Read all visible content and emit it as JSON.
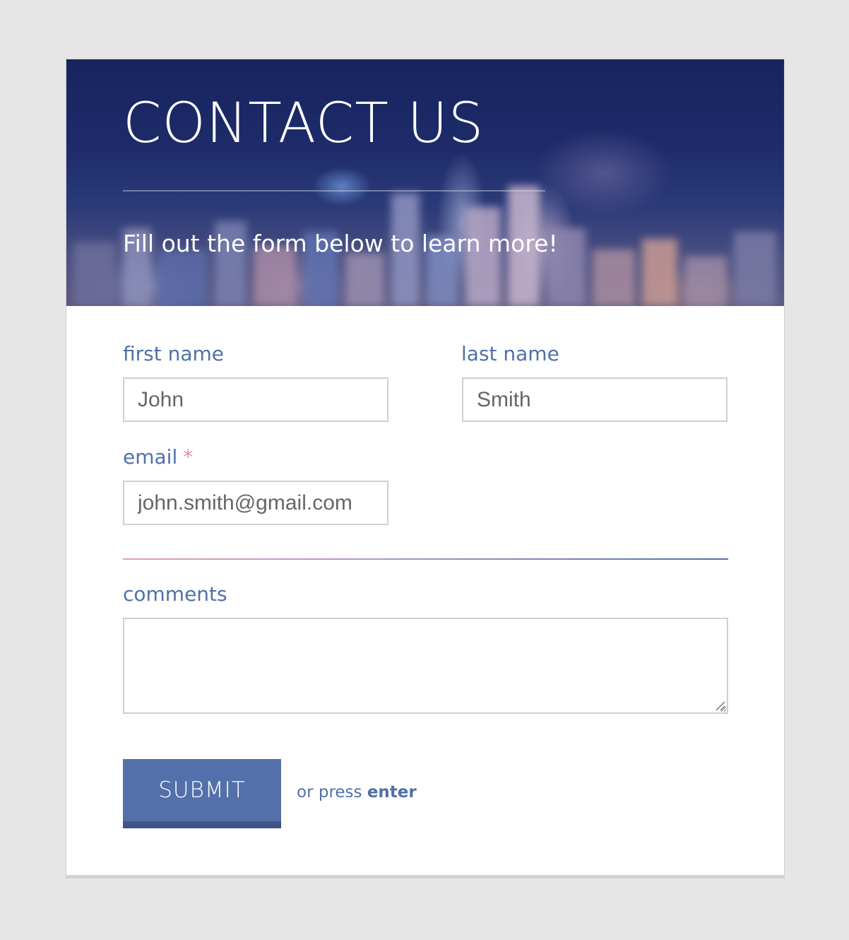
{
  "header": {
    "title": "CONTACT US",
    "subtitle": "Fill out the form below to learn more!"
  },
  "form": {
    "first_name": {
      "label": "first name",
      "value": "John"
    },
    "last_name": {
      "label": "last name",
      "value": "Smith"
    },
    "email": {
      "label": "email",
      "required_marker": "*",
      "value": "john.smith@gmail.com"
    },
    "comments": {
      "label": "comments",
      "value": ""
    },
    "submit_label": "SUBMIT",
    "hint_prefix": "or press",
    "hint_key": "enter"
  },
  "colors": {
    "accent": "#5370aa",
    "accent_dark": "#3f5487",
    "label": "#5170a8",
    "required": "#e08ab0",
    "page_background": "#e6e6e6"
  },
  "icons": {
    "textarea_grip": "resize-grip-icon"
  }
}
